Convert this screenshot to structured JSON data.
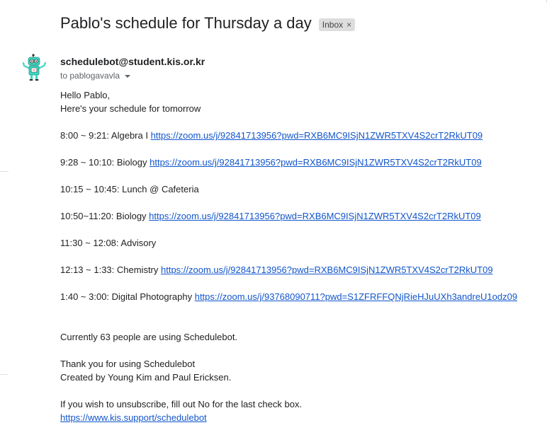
{
  "email": {
    "subject": "Pablo's schedule for Thursday a day",
    "label": "Inbox",
    "label_close": "×",
    "sender": "schedulebot@student.kis.or.kr",
    "to": "to pablogavavla",
    "greeting": "Hello Pablo,",
    "intro": "Here's your schedule for tomorrow",
    "schedule": [
      {
        "time_class": "8:00 ~ 9:21: Algebra I ",
        "link": "https://zoom.us/j/92841713956?pwd=RXB6MC9ISjN1ZWR5TXV4S2crT2RkUT09"
      },
      {
        "time_class": "9:28 ~ 10:10: Biology ",
        "link": "https://zoom.us/j/92841713956?pwd=RXB6MC9ISjN1ZWR5TXV4S2crT2RkUT09"
      },
      {
        "time_class": "10:15 ~ 10:45: Lunch @ Cafeteria",
        "link": ""
      },
      {
        "time_class": "10:50~11:20: Biology ",
        "link": "https://zoom.us/j/92841713956?pwd=RXB6MC9ISjN1ZWR5TXV4S2crT2RkUT09"
      },
      {
        "time_class": "11:30 ~ 12:08: Advisory",
        "link": ""
      },
      {
        "time_class": "12:13 ~ 1:33: Chemistry ",
        "link": "https://zoom.us/j/92841713956?pwd=RXB6MC9ISjN1ZWR5TXV4S2crT2RkUT09"
      },
      {
        "time_class": "1:40 ~ 3:00: Digital Photography ",
        "link": "https://zoom.us/j/93768090711?pwd=S1ZFRFFQNjRieHJuUXh3andreU1odz09"
      }
    ],
    "users_line": "Currently 63 people are using Schedulebot.",
    "thanks": "Thank you for using Schedulebot",
    "credits": "Created by Young Kim and Paul Ericksen.",
    "unsubscribe": "If you wish to unsubscribe, fill out No for the last check box.",
    "support_link": "https://www.kis.support/schedulebot"
  },
  "colors": {
    "link": "#1155cc",
    "chip_bg": "#dddddd",
    "robot_body": "#3dd9c1"
  },
  "icons": {
    "avatar": "robot-avatar-icon",
    "caret": "chevron-down-icon",
    "chip_close": "close-icon"
  }
}
